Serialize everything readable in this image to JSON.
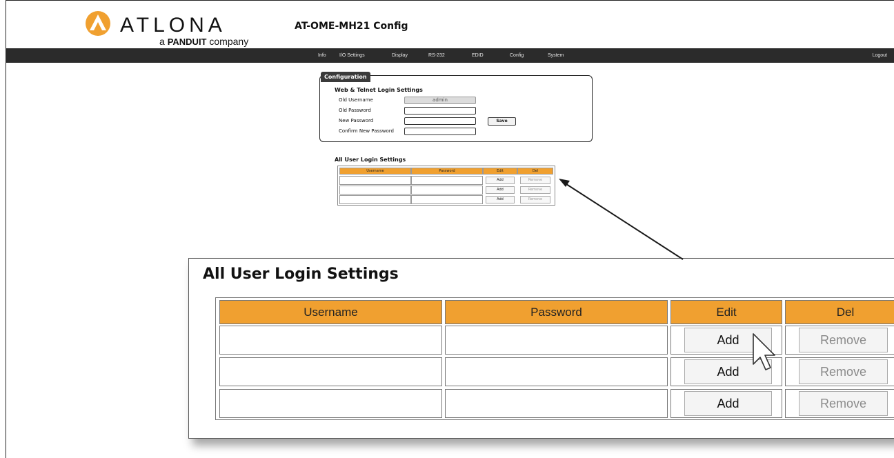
{
  "header": {
    "logo_word": "ATLONA",
    "logo_sub_prefix": "a",
    "logo_sub_brand": "PANDUIT",
    "logo_sub_suffix": "company",
    "model_title": "AT-OME-MH21  Config",
    "brand_color": "#f0a030"
  },
  "nav": {
    "items": [
      "Info",
      "I/O Settings",
      "Display",
      "RS-232",
      "EDID",
      "Config",
      "System"
    ],
    "logout": "Logout"
  },
  "config": {
    "tab_label": "Configuration",
    "heading": "Web & Telnet Login Settings",
    "fields": [
      {
        "label": "Old Username",
        "value": "admin",
        "readonly": true
      },
      {
        "label": "Old Password",
        "value": ""
      },
      {
        "label": "New Password",
        "value": ""
      },
      {
        "label": "Confirm New Password",
        "value": ""
      }
    ],
    "save_label": "Save"
  },
  "users": {
    "heading": "All User Login Settings",
    "columns": [
      "Username",
      "Password",
      "Edit",
      "Del"
    ],
    "rows": [
      {
        "username": "",
        "password": "",
        "edit": "Add",
        "del": "Remove"
      },
      {
        "username": "",
        "password": "",
        "edit": "Add",
        "del": "Remove"
      },
      {
        "username": "",
        "password": "",
        "edit": "Add",
        "del": "Remove"
      }
    ],
    "header_color": "#f0a030"
  },
  "zoom": {
    "heading": "All User Login Settings",
    "columns": [
      "Username",
      "Password",
      "Edit",
      "Del"
    ],
    "rows": [
      {
        "edit": "Add",
        "del": "Remove"
      },
      {
        "edit": "Add",
        "del": "Remove"
      },
      {
        "edit": "Add",
        "del": "Remove"
      }
    ]
  },
  "icons": {
    "logo": "atlona-logo-icon",
    "cursor": "mouse-pointer-icon",
    "arrow": "callout-arrow-icon"
  }
}
